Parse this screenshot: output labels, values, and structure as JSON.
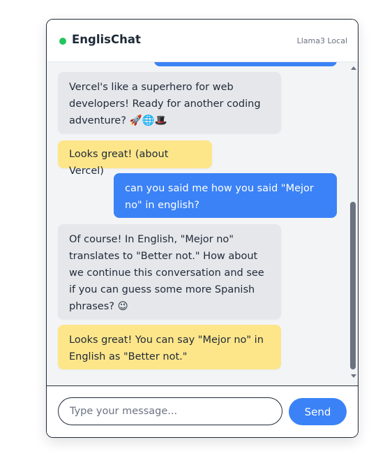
{
  "header": {
    "title": "EnglisChat",
    "model": "Llama3 Local",
    "status_color": "#22c55e"
  },
  "messages": [
    {
      "role": "user",
      "text": ""
    },
    {
      "role": "bot",
      "text": "Vercel's like a superhero for web developers! Ready for another coding adventure? 🚀🌐🎩"
    },
    {
      "role": "correction",
      "text": "Looks great! (about Vercel)"
    },
    {
      "role": "user",
      "text": "can you said me how you said \"Mejor no\" in english?"
    },
    {
      "role": "bot",
      "text": "Of course! In English, \"Mejor no\" translates to \"Better not.\" How about we continue this conversation and see if you can guess some more Spanish phrases? 😉"
    },
    {
      "role": "correction",
      "text": "Looks great! You can say \"Mejor no\" in English as \"Better not.\""
    }
  ],
  "input": {
    "placeholder": "Type your message...",
    "value": ""
  },
  "send_label": "Send",
  "colors": {
    "user_bubble": "#3b82f6",
    "bot_bubble": "#e5e7eb",
    "correction_bubble": "#fde68a"
  }
}
